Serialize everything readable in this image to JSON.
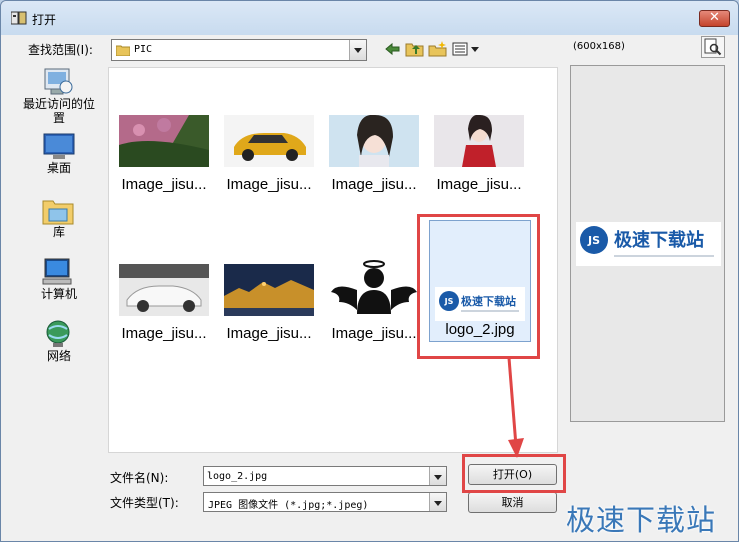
{
  "window": {
    "title": "打开",
    "close_glyph": "✕"
  },
  "toolbar": {
    "look_in_label": "查找范围(I):",
    "look_in_value": "PIC",
    "icons": [
      "back-icon",
      "up-folder-icon",
      "new-folder-icon",
      "view-menu-icon"
    ]
  },
  "places": [
    {
      "id": "recent",
      "label": "最近访问的位置",
      "icon": "recent-places-icon"
    },
    {
      "id": "desktop",
      "label": "桌面",
      "icon": "desktop-icon"
    },
    {
      "id": "libraries",
      "label": "库",
      "icon": "libraries-icon"
    },
    {
      "id": "computer",
      "label": "计算机",
      "icon": "computer-icon"
    },
    {
      "id": "network",
      "label": "网络",
      "icon": "network-icon"
    }
  ],
  "files": [
    {
      "name": "Image_jisu...",
      "icon": "photo-thumbnail"
    },
    {
      "name": "Image_jisu...",
      "icon": "photo-thumbnail"
    },
    {
      "name": "Image_jisu...",
      "icon": "photo-thumbnail"
    },
    {
      "name": "Image_jisu...",
      "icon": "photo-thumbnail"
    },
    {
      "name": "Image_jisu...",
      "icon": "photo-thumbnail"
    },
    {
      "name": "Image_jisu...",
      "icon": "photo-thumbnail"
    },
    {
      "name": "Image_jisu...",
      "icon": "photo-thumbnail"
    }
  ],
  "selected_file": {
    "name": "logo_2.jpg",
    "logo_text": "极速下载站",
    "logo_badge": "JS"
  },
  "preview": {
    "size": "(600x168)",
    "logo_text": "极速下载站",
    "logo_badge": "JS"
  },
  "filename": {
    "label": "文件名(N):",
    "value": "logo_2.jpg"
  },
  "filetype": {
    "label": "文件类型(T):",
    "value": "JPEG 图像文件 (*.jpg;*.jpeg)"
  },
  "buttons": {
    "open": "打开(O)",
    "cancel": "取消"
  },
  "watermark": "极速下载站",
  "colors": {
    "accent_red": "#e04646",
    "logo_blue": "#1a5aa8",
    "selection": "#e2eefc"
  }
}
